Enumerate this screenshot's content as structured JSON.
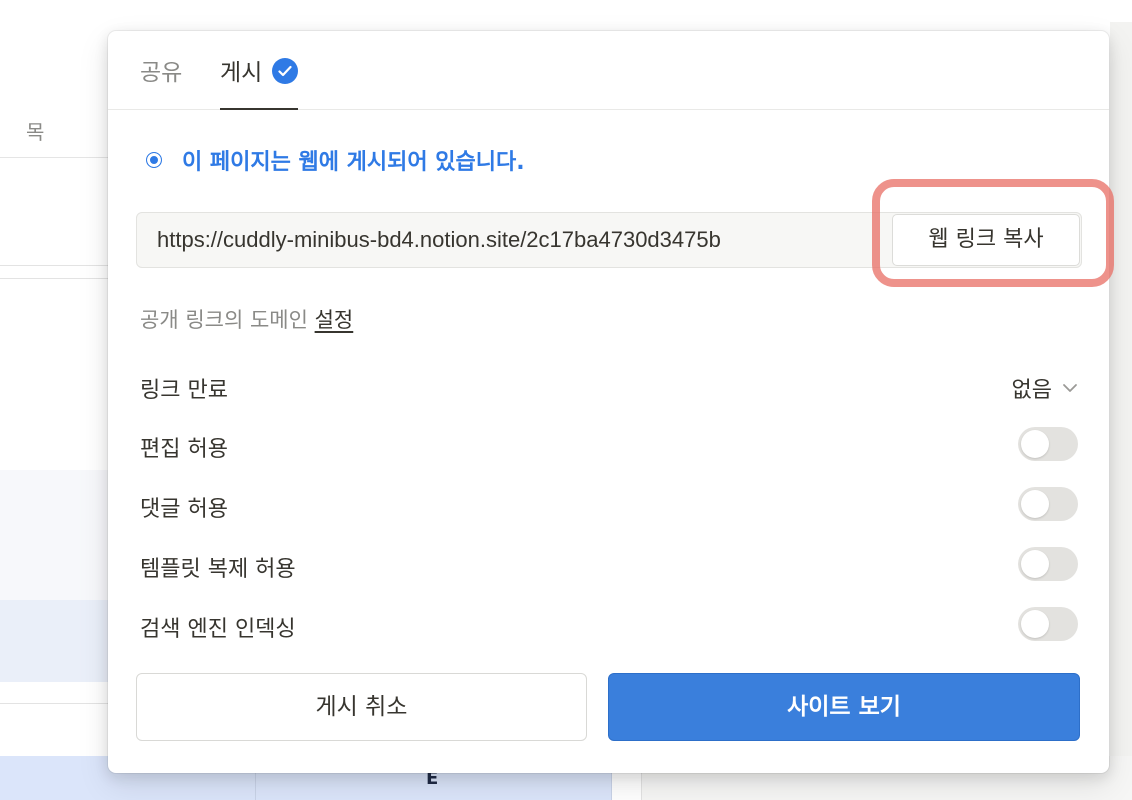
{
  "background": {
    "column_header": "목",
    "bottom_cell_label": "E"
  },
  "modal": {
    "tabs": [
      {
        "label": "공유",
        "active": false
      },
      {
        "label": "게시",
        "active": true
      }
    ],
    "status_text": "이 페이지는 웹에 게시되어 있습니다.",
    "url": "https://cuddly-minibus-bd4.notion.site/2c17ba4730d3475b",
    "copy_button_label": "웹 링크 복사",
    "domain_text": "공개 링크의 도메인",
    "domain_link": "설정",
    "settings": [
      {
        "label": "링크 만료",
        "type": "select",
        "value": "없음"
      },
      {
        "label": "편집 허용",
        "type": "toggle",
        "on": false
      },
      {
        "label": "댓글 허용",
        "type": "toggle",
        "on": false
      },
      {
        "label": "템플릿 복제 허용",
        "type": "toggle",
        "on": false
      },
      {
        "label": "검색 엔진 인덱싱",
        "type": "toggle",
        "on": false
      }
    ],
    "cancel_button_label": "게시 취소",
    "view_button_label": "사이트 보기"
  },
  "colors": {
    "accent": "#2f7ae5",
    "primary_button": "#3a7fdc",
    "highlight": "#e86e64"
  },
  "icons": {
    "publish_tab": "check-circle-icon",
    "status": "radio-dot-icon",
    "link_expiry": "chevron-down-icon"
  }
}
